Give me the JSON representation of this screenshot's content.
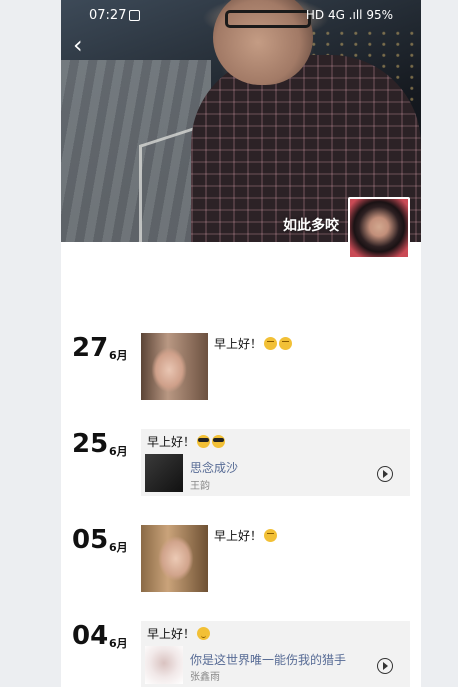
{
  "status_bar": {
    "time": "07:27",
    "right": "HD 4G .ıll 95%"
  },
  "header": {
    "username": "如此多咬"
  },
  "entries": [
    {
      "day": "27",
      "month": "6月",
      "text": "早上好！",
      "emoji": [
        "sleepy-face",
        "sleepy-face"
      ]
    },
    {
      "day": "25",
      "month": "6月",
      "text": "早上好！",
      "emoji": [
        "sunglasses-face",
        "sunglasses-face"
      ],
      "song": "思念成沙",
      "artist": "王韵"
    },
    {
      "day": "05",
      "month": "6月",
      "text": "早上好！",
      "emoji": [
        "sleepy-face"
      ]
    },
    {
      "day": "04",
      "month": "6月",
      "text": "早上好！",
      "emoji": [
        "smile-face"
      ],
      "song": "你是这世界唯一能伤我的猎手",
      "artist": "张鑫雨"
    }
  ],
  "colors": {
    "link": "#576b95",
    "share_bg": "#f2f2f2",
    "page_bg": "#eceef1"
  }
}
